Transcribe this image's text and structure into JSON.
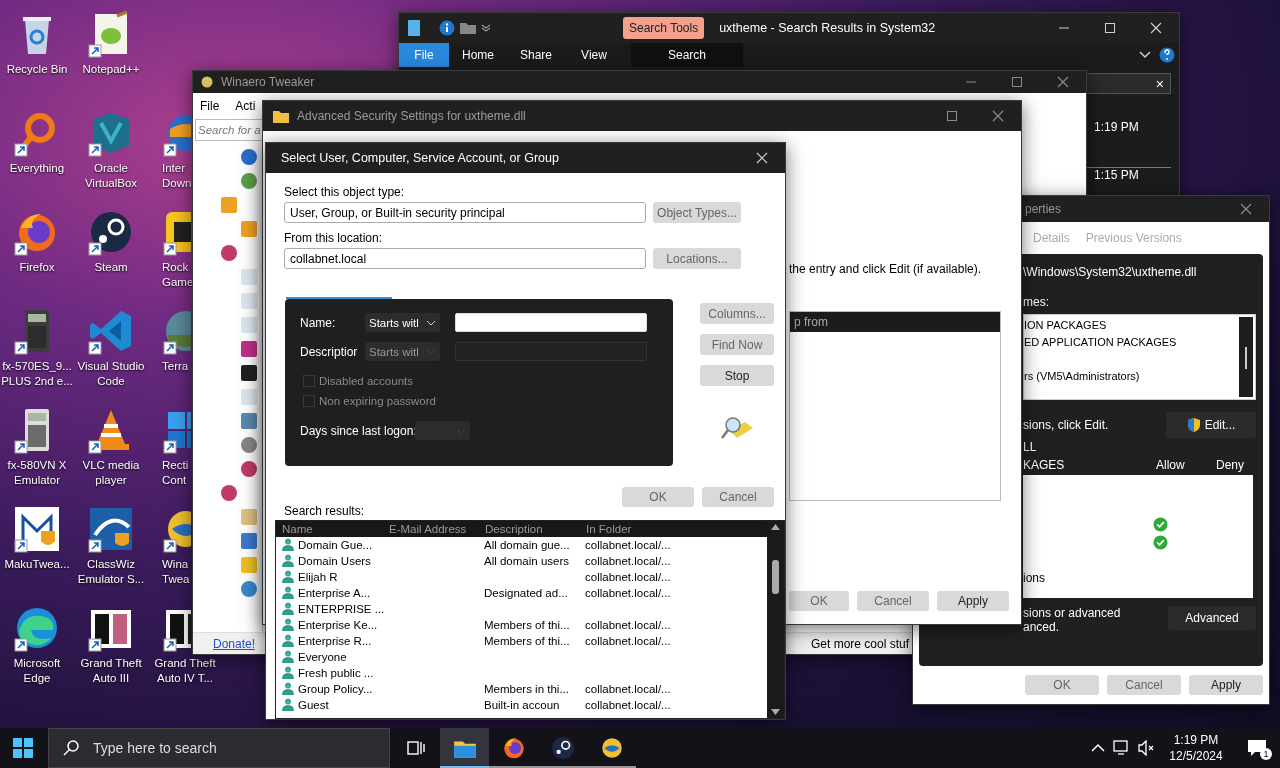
{
  "desktop_columns": [
    {
      "icons": [
        {
          "label": "Recycle Bin",
          "shortcut": false,
          "clipped": false
        },
        {
          "label": "Everything",
          "shortcut": true,
          "clipped": false
        },
        {
          "label": "Firefox",
          "shortcut": true,
          "clipped": false
        },
        {
          "label": "fx-570ES_9... PLUS 2nd e...",
          "shortcut": true,
          "clipped": false
        },
        {
          "label": "fx-580VN X Emulator",
          "shortcut": true,
          "clipped": false
        },
        {
          "label": "MakuTwea...",
          "shortcut": true,
          "clipped": false
        },
        {
          "label": "Microsoft Edge",
          "shortcut": true,
          "clipped": false
        }
      ]
    },
    {
      "icons": [
        {
          "label": "Notepad++",
          "shortcut": true,
          "clipped": false
        },
        {
          "label": "Oracle VirtualBox",
          "shortcut": true,
          "clipped": false
        },
        {
          "label": "Steam",
          "shortcut": true,
          "clipped": false
        },
        {
          "label": "Visual Studio Code",
          "shortcut": true,
          "clipped": false
        },
        {
          "label": "VLC media player",
          "shortcut": true,
          "clipped": false
        },
        {
          "label": "ClassWiz Emulator S...",
          "shortcut": true,
          "clipped": false
        },
        {
          "label": "Grand Theft Auto III",
          "shortcut": true,
          "clipped": false
        }
      ]
    },
    {
      "icons": [
        {
          "label": "Inter Down",
          "shortcut": true,
          "clipped": true
        },
        {
          "label": "Rock Game",
          "shortcut": true,
          "clipped": true
        },
        {
          "label": "Terra",
          "shortcut": true,
          "clipped": true
        },
        {
          "label": "Recti Cont",
          "shortcut": true,
          "clipped": true
        },
        {
          "label": "Wina Twea",
          "shortcut": true,
          "clipped": true
        },
        {
          "label": "Grand Theft Auto IV T...",
          "shortcut": true,
          "clipped": false
        }
      ]
    }
  ],
  "explorer": {
    "title": "uxtheme - Search Results in System32",
    "context_tab": "Search Tools",
    "ribbon_tabs": [
      {
        "label": "File",
        "kind": "menu",
        "selected": false
      },
      {
        "label": "Home",
        "kind": "tab",
        "selected": false
      },
      {
        "label": "Share",
        "kind": "tab",
        "selected": false
      },
      {
        "label": "View",
        "kind": "tab",
        "selected": false
      },
      {
        "label": "Search",
        "kind": "tab",
        "selected": true
      }
    ],
    "search_clear": "×",
    "times": [
      "1:19 PM",
      "1:15 PM"
    ]
  },
  "winaero": {
    "title": "Winaero Tweaker",
    "menu": [
      "File",
      "Acti"
    ],
    "search_placeholder": "Search for a",
    "donate_link": "Donate!",
    "footer_text": "Get more cool stuf"
  },
  "properties": {
    "title": "perties",
    "tabs": [
      {
        "label": "Details",
        "selected": false
      },
      {
        "label": "Previous Versions",
        "selected": false
      }
    ],
    "object_path": "\\Windows\\System32\\uxtheme.dll",
    "groups_label": "mes:",
    "groups": [
      "ION PACKAGES",
      "ED APPLICATION PACKAGES",
      "rs (VM5\\Administrators)"
    ],
    "edit_hint": "sions, click Edit.",
    "edit_button": "Edit...",
    "permissions_for": [
      "LL",
      "KAGES"
    ],
    "permission_columns": [
      "Allow",
      "Deny"
    ],
    "permissions": [
      {
        "allow": false
      },
      {
        "allow": false
      },
      {
        "allow": true
      },
      {
        "allow": true
      },
      {
        "allow": false
      },
      {
        "label": "ions",
        "allow": false
      }
    ],
    "advanced_hint": [
      "sions or advanced",
      "anced."
    ],
    "advanced_button": "Advanced",
    "buttons": [
      {
        "label": "OK",
        "disabled": true
      },
      {
        "label": "Cancel",
        "disabled": true
      },
      {
        "label": "Apply",
        "disabled": false
      }
    ]
  },
  "advanced_security": {
    "title": "Advanced Security Settings for uxtheme.dll",
    "instruction": "the entry and click Edit (if available).",
    "list_header": "p from",
    "buttons": [
      {
        "label": "OK",
        "disabled": true
      },
      {
        "label": "Cancel",
        "disabled": true
      },
      {
        "label": "Apply",
        "disabled": false
      }
    ]
  },
  "select_dialog": {
    "title": "Select User, Computer, Service Account, or Group",
    "object_type_label": "Select this object type:",
    "object_type_value": "User, Group, or Built-in security principal",
    "object_types_button": {
      "label": "Object Types...",
      "disabled": true
    },
    "location_label": "From this location:",
    "location_value": "collabnet.local",
    "locations_button": {
      "label": "Locations...",
      "disabled": true
    },
    "query": {
      "name_label": "Name:",
      "name_match": {
        "label": "Starts witl",
        "disabled": false
      },
      "description_label": "Descriptior",
      "description_match": {
        "label": "Starts witl",
        "disabled": true
      },
      "checkboxes": [
        {
          "label": "Disabled accounts",
          "checked": false,
          "disabled": true
        },
        {
          "label": "Non expiring password",
          "checked": false,
          "disabled": true
        }
      ],
      "days_label": "Days since last logon:"
    },
    "side_buttons": [
      {
        "label": "Columns...",
        "disabled": true
      },
      {
        "label": "Find Now",
        "disabled": true
      },
      {
        "label": "Stop",
        "disabled": false
      }
    ],
    "buttons": [
      {
        "label": "OK",
        "disabled": true
      },
      {
        "label": "Cancel",
        "disabled": true
      }
    ],
    "results_label": "Search results:",
    "columns": [
      "Name",
      "E-Mail Address",
      "Description",
      "In Folder"
    ],
    "rows": [
      {
        "name": "Domain Gue...",
        "description": "All domain gue...",
        "folder": "collabnet.local/..."
      },
      {
        "name": "Domain Users",
        "description": "All domain users",
        "folder": "collabnet.local/..."
      },
      {
        "name": "Elijah R",
        "folder": "collabnet.local/..."
      },
      {
        "name": "Enterprise A...",
        "description": "Designated ad...",
        "folder": "collabnet.local/..."
      },
      {
        "name": "ENTERPRISE ..."
      },
      {
        "name": "Enterprise Ke...",
        "description": "Members of thi...",
        "folder": "collabnet.local/..."
      },
      {
        "name": "Enterprise R...",
        "description": "Members of thi...",
        "folder": "collabnet.local/..."
      },
      {
        "name": "Everyone"
      },
      {
        "name": "Fresh public ..."
      },
      {
        "name": "Group Policy...",
        "description": "Members in thi...",
        "folder": "collabnet.local/..."
      },
      {
        "name": "Guest",
        "description": "Built-in accoun",
        "folder": "collabnet.local/..."
      }
    ]
  },
  "taskbar": {
    "search_placeholder": "Type here to search",
    "apps": [
      {
        "selected": true
      },
      {
        "selected": false
      },
      {
        "selected": false
      },
      {
        "selected": false
      }
    ],
    "time": "1:19 PM",
    "date": "12/5/2024",
    "notification_count": "1"
  }
}
